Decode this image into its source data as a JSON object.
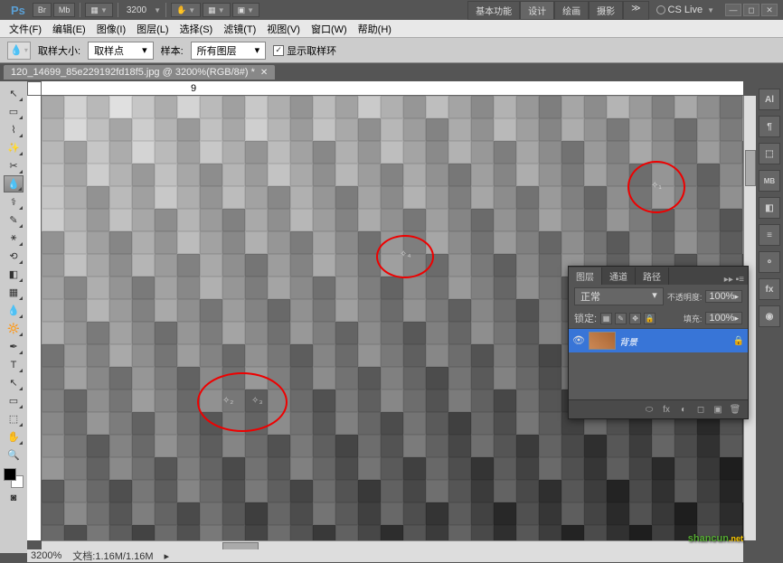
{
  "app": {
    "logo": "Ps",
    "br": "Br",
    "mb": "Mb"
  },
  "top": {
    "zoom": "3200",
    "workspace": [
      "基本功能",
      "设计",
      "绘画",
      "摄影"
    ],
    "active_ws": 1,
    "more": "≫",
    "cslive": "CS Live",
    "win": [
      "—",
      "◻",
      "✕"
    ]
  },
  "menu": [
    "文件(F)",
    "编辑(E)",
    "图像(I)",
    "图层(L)",
    "选择(S)",
    "滤镜(T)",
    "视图(V)",
    "窗口(W)",
    "帮助(H)"
  ],
  "options": {
    "label1": "取样大小:",
    "value1": "取样点",
    "label2": "样本:",
    "value2": "所有图层",
    "checkbox": "显示取样环"
  },
  "doc": {
    "tab": "120_14699_85e229192fd18f5.jpg @ 3200%(RGB/8#) *",
    "ruler_mark": "9"
  },
  "markers": {
    "m1": "✧₁",
    "m2": "✧₂",
    "m3": "✧₃",
    "m4": "✧₄"
  },
  "dock": [
    "Al",
    "¶",
    "⬚",
    "MB",
    "◧",
    "≡",
    "⚬",
    "fx",
    "◉"
  ],
  "layers": {
    "tabs": [
      "图层",
      "通道",
      "路径"
    ],
    "blend": "正常",
    "opacity_lbl": "不透明度:",
    "opacity_val": "100%",
    "fill_lbl": "填充:",
    "fill_val": "100%",
    "lock_lbl": "锁定:",
    "layer_name": "背景",
    "footer": [
      "⬭",
      "fx",
      "◐",
      "◻",
      "▣",
      "🗑"
    ]
  },
  "status": {
    "zoom": "3200%",
    "doc_size": "文档:1.16M/1.16M"
  },
  "watermark": {
    "text": "shancun",
    "suffix": ".net"
  }
}
